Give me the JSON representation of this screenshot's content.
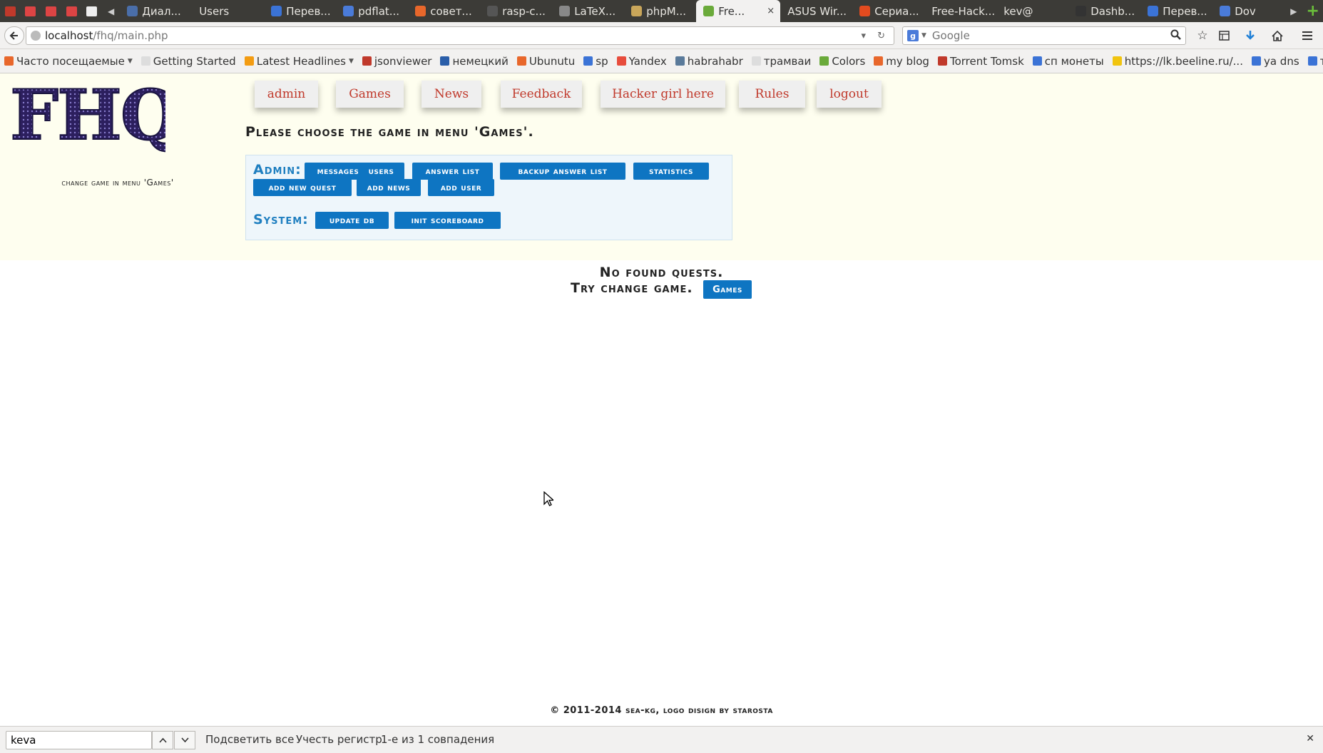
{
  "browser": {
    "tabs": [
      {
        "label": "Диал...",
        "color": "#4a6ea9"
      },
      {
        "label": "Users",
        "color": ""
      },
      {
        "label": "Перев...",
        "color": "#3b73d6"
      },
      {
        "label": "pdflat...",
        "color": "#4a7bd9"
      },
      {
        "label": "совет...",
        "color": "#e8672b"
      },
      {
        "label": "rasp-c...",
        "color": "#555555"
      },
      {
        "label": "LaTeX...",
        "color": "#888888"
      },
      {
        "label": "phpM...",
        "color": "#c9a65a"
      },
      {
        "label": "Fre...",
        "color": "#6aaa3a"
      },
      {
        "label": "ASUS Wir...",
        "color": ""
      },
      {
        "label": "Сериа...",
        "color": "#e24b1f"
      },
      {
        "label": "Free-Hack...",
        "color": ""
      },
      {
        "label": "kev@",
        "color": ""
      },
      {
        "label": "Dashb...",
        "color": "#333333"
      },
      {
        "label": "Перев...",
        "color": "#3b73d6"
      },
      {
        "label": "Dov",
        "color": "#4a7bd9"
      }
    ],
    "active_tab_close": "×",
    "url_host": "localhost",
    "url_path": "/fhq/main.php",
    "search_placeholder": "Google",
    "bookmarks": [
      {
        "label": "Часто посещаемые",
        "dropdown": true,
        "color": "#e8672b"
      },
      {
        "label": "Getting Started",
        "dropdown": false,
        "color": "#dddddd"
      },
      {
        "label": "Latest Headlines",
        "dropdown": true,
        "color": "#f39c12"
      },
      {
        "label": "jsonviewer",
        "dropdown": false,
        "color": "#c0392b"
      },
      {
        "label": "немецкий",
        "dropdown": false,
        "color": "#2a5ea9"
      },
      {
        "label": "Ubunutu",
        "dropdown": false,
        "color": "#e8672b"
      },
      {
        "label": "sp",
        "dropdown": false,
        "color": "#3b73d6"
      },
      {
        "label": "Yandex",
        "dropdown": false,
        "color": "#e74c3c"
      },
      {
        "label": "habrahabr",
        "dropdown": false,
        "color": "#5a7a9a"
      },
      {
        "label": "трамваи",
        "dropdown": false,
        "color": "#dddddd"
      },
      {
        "label": "Colors",
        "dropdown": false,
        "color": "#6aaa3a"
      },
      {
        "label": "my blog",
        "dropdown": false,
        "color": "#e8672b"
      },
      {
        "label": "Torrent Tomsk",
        "dropdown": false,
        "color": "#c0392b"
      },
      {
        "label": "сп монеты",
        "dropdown": false,
        "color": "#3b73d6"
      },
      {
        "label": "https://lk.beeline.ru/...",
        "dropdown": false,
        "color": "#f1c40f"
      },
      {
        "label": "ya dns",
        "dropdown": false,
        "color": "#3b73d6"
      },
      {
        "label": "тая",
        "dropdown": false,
        "color": "#3b73d6"
      }
    ]
  },
  "site": {
    "logo_text": "FHQ",
    "side_note": "change game in menu 'Games'",
    "menu": [
      {
        "label": "admin",
        "key": "admin"
      },
      {
        "label": "Games",
        "key": "games"
      },
      {
        "label": "News",
        "key": "news"
      },
      {
        "label": "Feedback",
        "key": "feedback"
      },
      {
        "label": "Hacker girl here",
        "key": "hacker-girl"
      },
      {
        "label": "Rules",
        "key": "rules"
      },
      {
        "label": "logout",
        "key": "logout"
      }
    ],
    "choose_title": "Please choose the game in menu 'Games'.",
    "admin_label": "Admin:",
    "admin_buttons": [
      {
        "label": "messages",
        "key": "messages"
      },
      {
        "label": "users",
        "key": "users"
      },
      {
        "label": "answer list",
        "key": "answer-list"
      },
      {
        "label": "backup answer list",
        "key": "backup-answer-list"
      },
      {
        "label": "statistics",
        "key": "statistics"
      },
      {
        "label": "add new quest",
        "key": "add-new-quest"
      },
      {
        "label": "add news",
        "key": "add-news"
      },
      {
        "label": "add user",
        "key": "add-user"
      }
    ],
    "system_label": "System:",
    "system_buttons": [
      {
        "label": "update db",
        "key": "update-db"
      },
      {
        "label": "init scoreboard",
        "key": "init-scoreboard"
      }
    ],
    "no_quests_line1": "No found quests.",
    "no_quests_line2": "Try change game.",
    "games_button": "Games",
    "footer": "© 2011-2014 sea-kg, logo disign by starosta",
    "accent_color": "#0e75c2",
    "menu_text_color": "#c0392b"
  },
  "findbar": {
    "query": "keva",
    "highlight_all": "Подсветить все",
    "match_case": "Учесть регистр",
    "result": "1-е из 1 совпадения"
  }
}
